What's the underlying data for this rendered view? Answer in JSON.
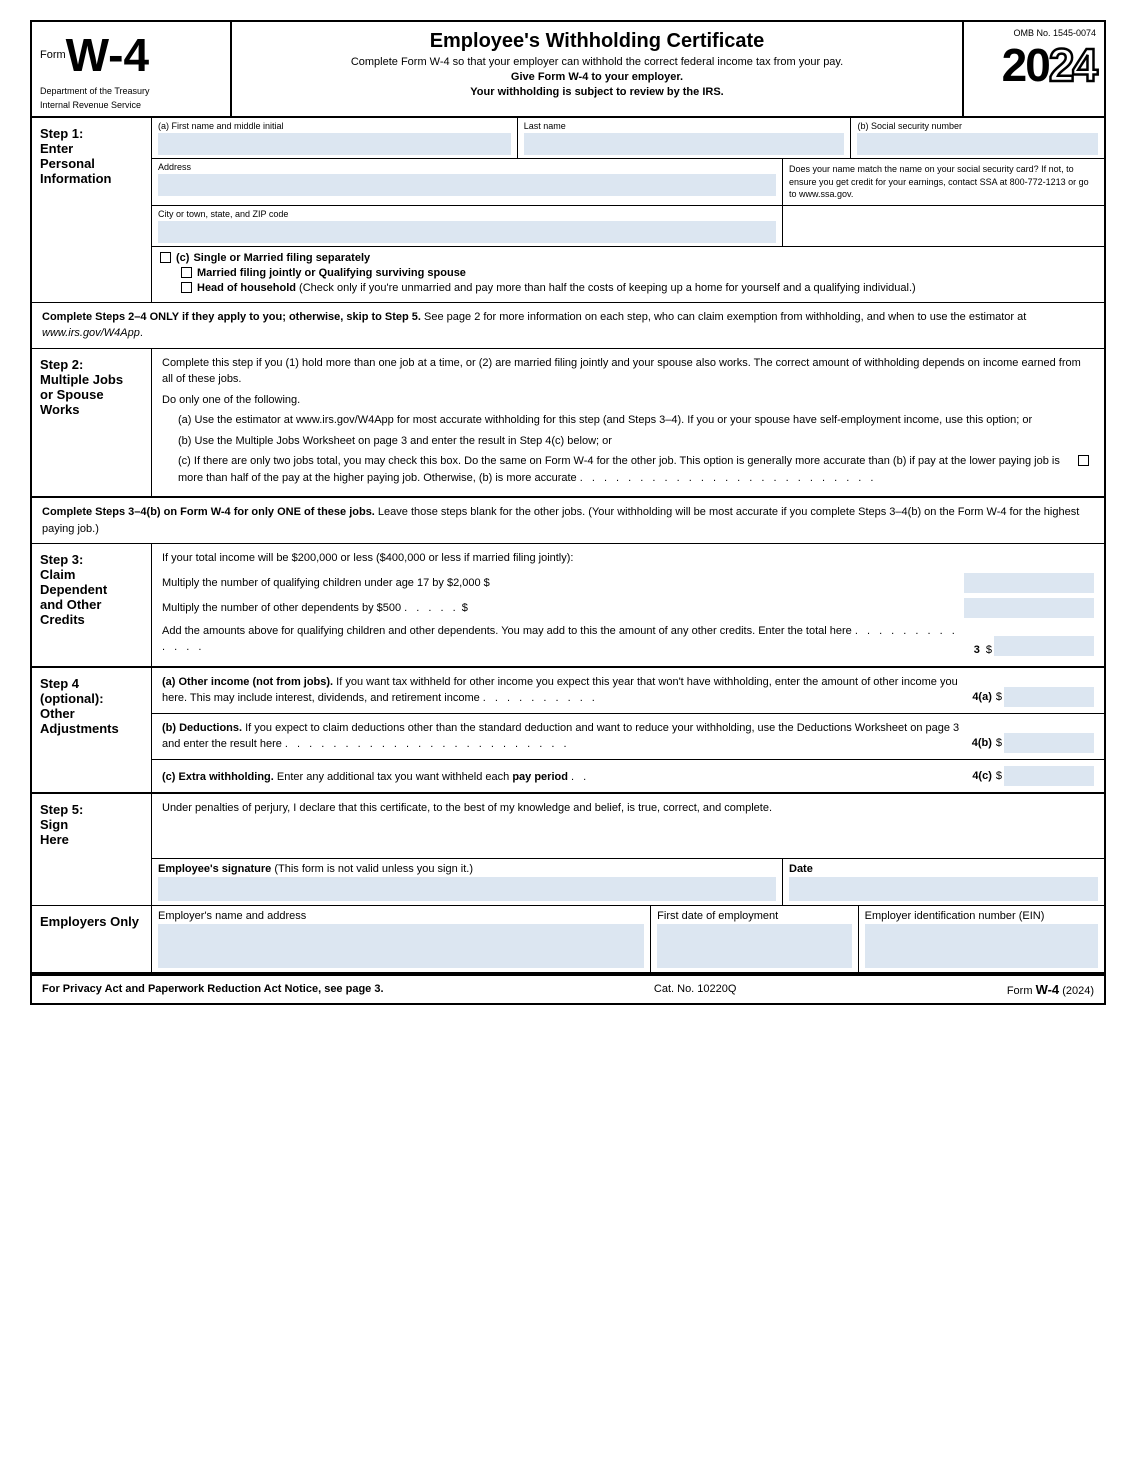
{
  "header": {
    "form_label": "Form",
    "form_number": "W-4",
    "title": "Employee's Withholding Certificate",
    "subtitle1": "Complete Form W-4 so that your employer can withhold the correct federal income tax from your pay.",
    "subtitle2": "Give Form W-4 to your employer.",
    "subtitle3": "Your withholding is subject to review by the IRS.",
    "omb": "OMB No. 1545-0074",
    "year": "2024",
    "dept": "Department of the Treasury",
    "irs": "Internal Revenue Service"
  },
  "step1": {
    "number": "Step 1:",
    "title": "Enter",
    "title2": "Personal",
    "title3": "Information",
    "field_a_label": "(a)  First name and middle initial",
    "field_lastname_label": "Last name",
    "field_b_label": "(b)  Social security number",
    "address_label": "Address",
    "city_label": "City or town, state, and ZIP code",
    "ssn_note": "Does your name match the name on your social security card? If not, to ensure you get credit for your earnings, contact SSA at 800-772-1213 or go to www.ssa.gov.",
    "filing_c_label": "(c)",
    "filing_options": [
      "Single or Married filing separately",
      "Married filing jointly or Qualifying surviving spouse",
      "Head of household (Check only if you're unmarried and pay more than half the costs of keeping up a home for yourself and a qualifying individual.)"
    ]
  },
  "complete_note": {
    "text1": "Complete Steps 2–4 ONLY if they apply to you; otherwise, skip to Step 5. See page 2 for more information on each step, who can",
    "text2": "claim exemption from withholding, and when to use the estimator at www.irs.gov/W4App."
  },
  "step2": {
    "number": "Step 2:",
    "title": "Multiple Jobs",
    "title2": "or Spouse",
    "title3": "Works",
    "intro": "Complete this step if you (1) hold more than one job at a time, or (2) are married filing jointly and your spouse also works. The correct amount of withholding depends on income earned from all of these jobs.",
    "do_one": "Do only one of the following.",
    "item_a": "(a) Use the estimator at www.irs.gov/W4App for most accurate withholding for this step (and Steps 3–4). If you or your spouse have self-employment income, use this option; or",
    "item_b": "(b) Use the Multiple Jobs Worksheet on page 3 and enter the result in Step 4(c) below; or",
    "item_c": "(c) If there are only two jobs total, you may check this box. Do the same on Form W-4 for the other job. This option is generally more accurate than (b) if pay at the lower paying job is more than half of the pay at the higher paying job. Otherwise, (b) is more accurate"
  },
  "step3_note": {
    "text1": "Complete Steps 3–4(b) on Form W-4 for only ONE of these jobs.",
    "text2": "Leave those steps blank for the other jobs. (Your withholding will be most accurate if you complete Steps 3–4(b) on the Form W-4 for the highest paying job.)"
  },
  "step3": {
    "number": "Step 3:",
    "title": "Claim",
    "title2": "Dependent",
    "title3": "and Other",
    "title4": "Credits",
    "intro": "If your total income will be $200,000 or less ($400,000 or less if married filing jointly):",
    "row1_text": "Multiply the number of qualifying children under age 17 by $2,000",
    "row1_symbol": "$",
    "row2_text": "Multiply the number of other dependents by $500",
    "row2_dots": ". . . . .",
    "row2_symbol": "$",
    "add_text": "Add the amounts above for qualifying children and other dependents. You may add to this the amount of any other credits. Enter the total here",
    "add_dots": ". . . . . . . . . . . . .",
    "add_number": "3",
    "add_symbol": "$"
  },
  "step4": {
    "number": "Step 4",
    "subtitle": "(optional):",
    "title": "Other",
    "title2": "Adjustments",
    "item_a_label": "4(a)",
    "item_a_symbol": "$",
    "item_a_text": "(a) Other income (not from jobs). If you want tax withheld for other income you expect this year that won't have withholding, enter the amount of other income you here. This may include interest, dividends, and retirement income",
    "item_a_dots": ". . . . . . . . . .",
    "item_b_label": "4(b)",
    "item_b_symbol": "$",
    "item_b_text": "(b) Deductions. If you expect to claim deductions other than the standard deduction and want to reduce your withholding, use the Deductions Worksheet on page 3 and enter the result here",
    "item_b_dots": ". . . . . . . . . . . . . . . . . . . . . . . .",
    "item_c_label": "4(c)",
    "item_c_symbol": "$",
    "item_c_text": "(c) Extra withholding. Enter any additional tax you want withheld each",
    "item_c_bold": "pay period",
    "item_c_dots": ". ."
  },
  "step5": {
    "number": "Step 5:",
    "title": "Sign",
    "title2": "Here",
    "declaration": "Under penalties of perjury, I declare that this certificate, to the best of my knowledge and belief, is true, correct, and complete.",
    "sig_label": "Employee's signature",
    "sig_note": "(This form is not valid unless you sign it.)",
    "date_label": "Date"
  },
  "employers": {
    "label": "Employers Only",
    "name_addr_label": "Employer's name and address",
    "first_date_label": "First date of employment",
    "ein_label": "Employer identification number (EIN)"
  },
  "footer": {
    "privacy": "For Privacy Act and Paperwork Reduction Act Notice, see page 3.",
    "cat": "Cat. No. 10220Q",
    "form_label": "Form",
    "form_number": "W-4",
    "year": "(2024)"
  }
}
